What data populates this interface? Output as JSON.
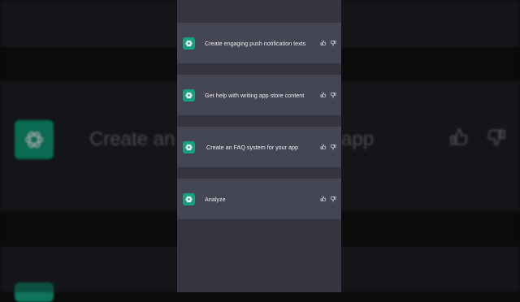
{
  "colors": {
    "column_bg": "#343541",
    "row_bg": "#444654",
    "accent": "#10a37f",
    "text": "#ececf1"
  },
  "background": {
    "zoomed_prompt_left": "Create an F",
    "zoomed_prompt_right": "app"
  },
  "chat": {
    "rows": [
      {
        "text": "Create engaging push notification texts",
        "avatar_icon": "chatgpt-logo-icon"
      },
      {
        "text": "Get help with writing app store content",
        "avatar_icon": "chatgpt-logo-icon"
      },
      {
        "text": "Create an  FAQ system for your app",
        "avatar_icon": "chatgpt-logo-icon"
      },
      {
        "text": "Analyze",
        "avatar_icon": "chatgpt-logo-icon"
      }
    ],
    "row_icons": [
      "thumbs-up-icon",
      "thumbs-down-icon"
    ]
  }
}
